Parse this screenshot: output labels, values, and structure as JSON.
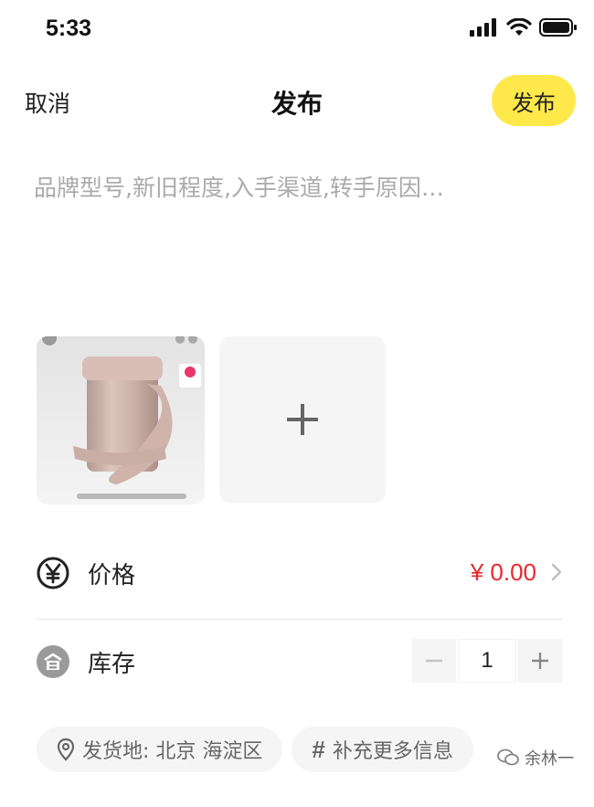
{
  "status_bar": {
    "time": "5:33"
  },
  "nav": {
    "cancel_label": "取消",
    "title": "发布",
    "publish_label": "发布"
  },
  "description": {
    "placeholder": "品牌型号,新旧程度,入手渠道,转手原因…",
    "value": ""
  },
  "photos": {
    "count": 1,
    "add_icon": "plus-icon"
  },
  "price": {
    "label": "价格",
    "value": "¥ 0.00",
    "icon": "yuan-circle-icon"
  },
  "stock": {
    "label": "库存",
    "quantity": "1",
    "icon": "warehouse-icon"
  },
  "chips": {
    "location_label": "发货地: 北京 海淀区",
    "more_hash": "#",
    "more_label": "补充更多信息"
  },
  "watermark": {
    "text": "余林一"
  },
  "colors": {
    "accent": "#ffe94a",
    "price": "#e8292e",
    "chip_bg": "#f5f5f5"
  }
}
